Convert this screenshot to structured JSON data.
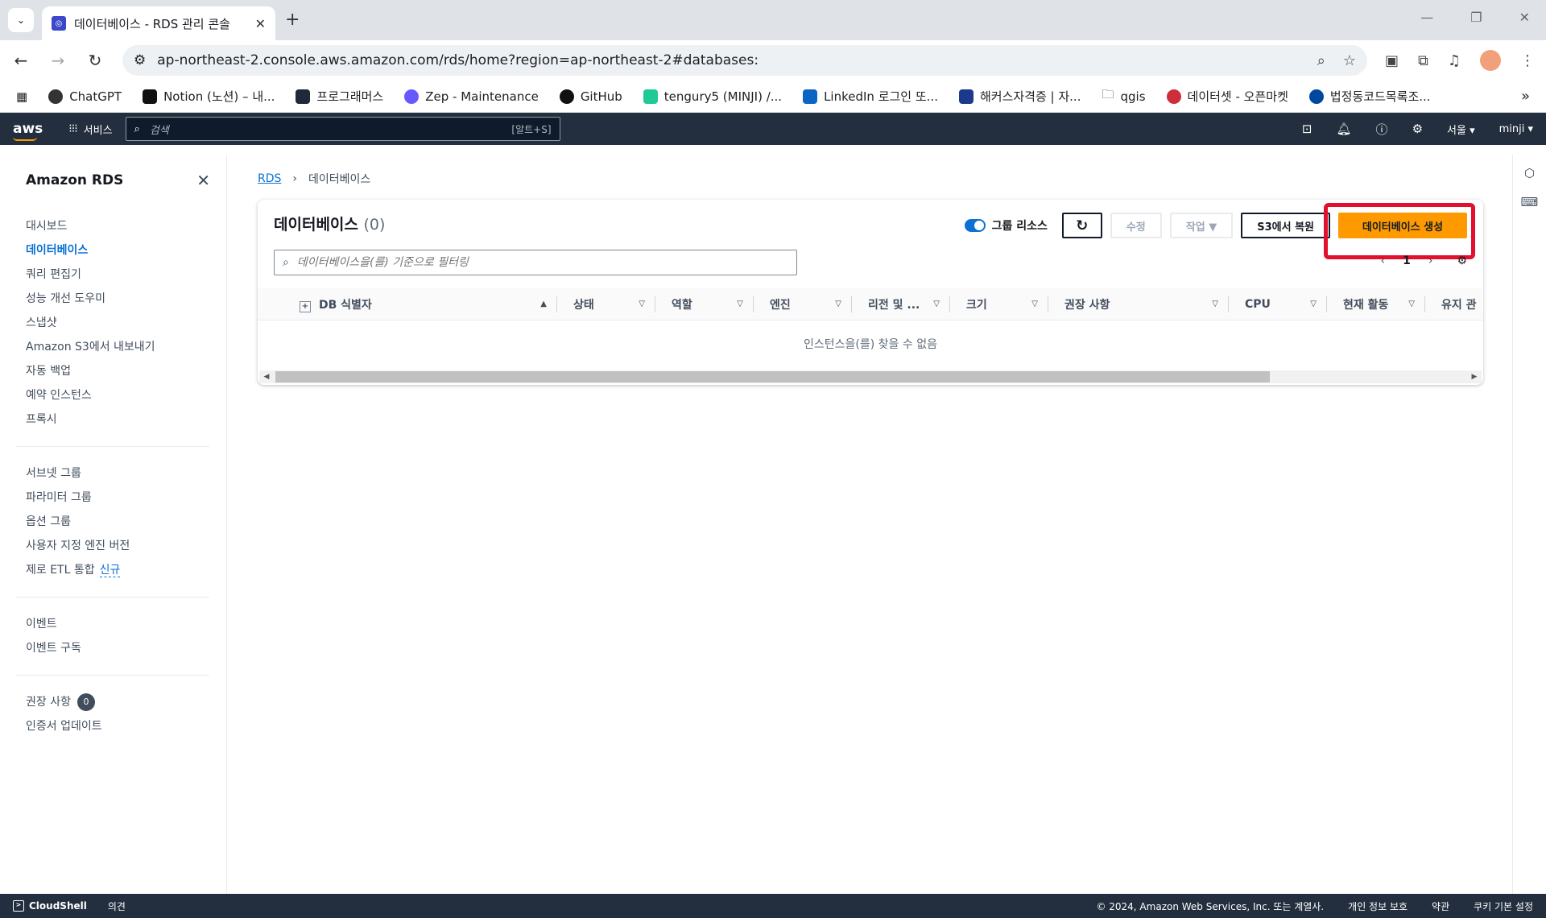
{
  "browser": {
    "tab_title": "데이터베이스 - RDS 관리 콘솔",
    "url": "ap-northeast-2.console.aws.amazon.com/rds/home?region=ap-northeast-2#databases:",
    "bookmarks": [
      {
        "label": "ChatGPT"
      },
      {
        "label": "Notion (노션) – 내..."
      },
      {
        "label": "프로그래머스"
      },
      {
        "label": "Zep - Maintenance"
      },
      {
        "label": "GitHub"
      },
      {
        "label": "tengury5 (MINJI) /..."
      },
      {
        "label": "LinkedIn 로그인 또..."
      },
      {
        "label": "해커스자격증 | 자..."
      },
      {
        "label": "qgis"
      },
      {
        "label": "데이터셋 - 오픈마켓"
      },
      {
        "label": "법정동코드목록조..."
      }
    ]
  },
  "aws_nav": {
    "logo": "aws",
    "services": "서비스",
    "search_placeholder": "검색",
    "search_shortcut": "[알트+S]",
    "region": "서울 ▾",
    "user": "minji ▾"
  },
  "sidebar": {
    "title": "Amazon RDS",
    "group1": [
      {
        "label": "대시보드",
        "active": false
      },
      {
        "label": "데이터베이스",
        "active": true
      },
      {
        "label": "쿼리 편집기",
        "active": false
      },
      {
        "label": "성능 개선 도우미",
        "active": false
      },
      {
        "label": "스냅샷",
        "active": false
      },
      {
        "label": "Amazon S3에서 내보내기",
        "active": false
      },
      {
        "label": "자동 백업",
        "active": false
      },
      {
        "label": "예약 인스턴스",
        "active": false
      },
      {
        "label": "프록시",
        "active": false
      }
    ],
    "group2": [
      {
        "label": "서브넷 그룹"
      },
      {
        "label": "파라미터 그룹"
      },
      {
        "label": "옵션 그룹"
      },
      {
        "label": "사용자 지정 엔진 버전"
      },
      {
        "label": "제로 ETL 통합"
      }
    ],
    "new_badge": "신규",
    "group3": [
      {
        "label": "이벤트"
      },
      {
        "label": "이벤트 구독"
      }
    ],
    "group4": [
      {
        "label": "권장 사항"
      },
      {
        "label": "인증서 업데이트"
      }
    ],
    "recommendation_count": "0"
  },
  "breadcrumb": {
    "root": "RDS",
    "current": "데이터베이스"
  },
  "panel": {
    "title": "데이터베이스",
    "count": "(0)",
    "group_toggle_label": "그룹 리소스",
    "group_toggle_on": true,
    "buttons": {
      "modify": "수정",
      "actions": "작업 ▼",
      "restore_s3": "S3에서 복원",
      "create": "데이터베이스 생성"
    },
    "filter_placeholder": "데이터베이스을(를) 기준으로 필터링",
    "page": "1",
    "columns": [
      {
        "label": "DB 식별자",
        "sort": "▲"
      },
      {
        "label": "상태",
        "sort": "▽"
      },
      {
        "label": "역할",
        "sort": "▽"
      },
      {
        "label": "엔진",
        "sort": "▽"
      },
      {
        "label": "리전 및 ...",
        "sort": "▽"
      },
      {
        "label": "크기",
        "sort": "▽"
      },
      {
        "label": "권장 사항",
        "sort": "▽"
      },
      {
        "label": "CPU",
        "sort": "▽"
      },
      {
        "label": "현재 활동",
        "sort": "▽"
      },
      {
        "label": "유지 관",
        "sort": ""
      }
    ],
    "empty_text": "인스턴스을(를) 찾을 수 없음"
  },
  "footer": {
    "cloudshell": "CloudShell",
    "feedback": "의견",
    "copyright": "© 2024, Amazon Web Services, Inc. 또는 계열사.",
    "privacy": "개인 정보 보호",
    "terms": "약관",
    "cookies": "쿠키 기본 설정"
  },
  "colors": {
    "aws_dark": "#232f3e",
    "primary_orange": "#ff9900",
    "link_blue": "#0972d3",
    "highlight_red": "#e0102e"
  }
}
